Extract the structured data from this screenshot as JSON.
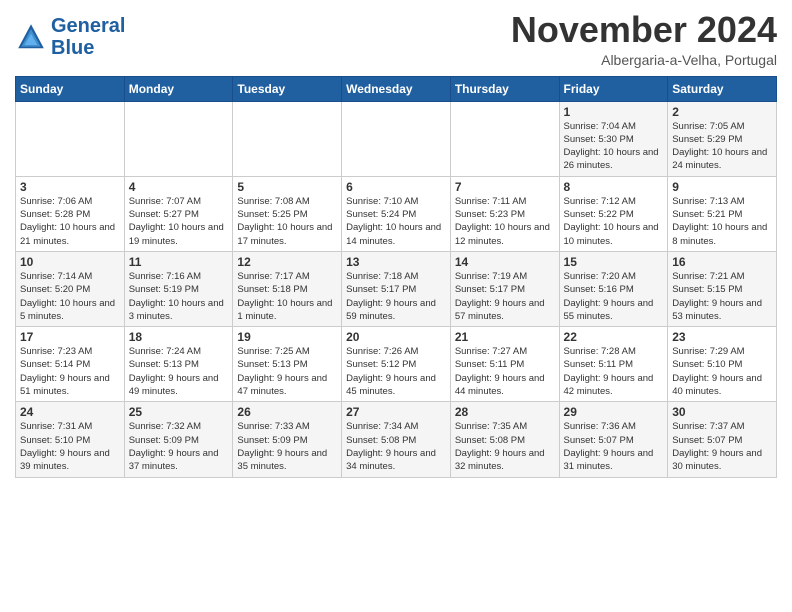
{
  "logo": {
    "line1": "General",
    "line2": "Blue"
  },
  "header": {
    "month": "November 2024",
    "location": "Albergaria-a-Velha, Portugal"
  },
  "weekdays": [
    "Sunday",
    "Monday",
    "Tuesday",
    "Wednesday",
    "Thursday",
    "Friday",
    "Saturday"
  ],
  "weeks": [
    [
      {
        "day": "",
        "info": ""
      },
      {
        "day": "",
        "info": ""
      },
      {
        "day": "",
        "info": ""
      },
      {
        "day": "",
        "info": ""
      },
      {
        "day": "",
        "info": ""
      },
      {
        "day": "1",
        "info": "Sunrise: 7:04 AM\nSunset: 5:30 PM\nDaylight: 10 hours and 26 minutes."
      },
      {
        "day": "2",
        "info": "Sunrise: 7:05 AM\nSunset: 5:29 PM\nDaylight: 10 hours and 24 minutes."
      }
    ],
    [
      {
        "day": "3",
        "info": "Sunrise: 7:06 AM\nSunset: 5:28 PM\nDaylight: 10 hours and 21 minutes."
      },
      {
        "day": "4",
        "info": "Sunrise: 7:07 AM\nSunset: 5:27 PM\nDaylight: 10 hours and 19 minutes."
      },
      {
        "day": "5",
        "info": "Sunrise: 7:08 AM\nSunset: 5:25 PM\nDaylight: 10 hours and 17 minutes."
      },
      {
        "day": "6",
        "info": "Sunrise: 7:10 AM\nSunset: 5:24 PM\nDaylight: 10 hours and 14 minutes."
      },
      {
        "day": "7",
        "info": "Sunrise: 7:11 AM\nSunset: 5:23 PM\nDaylight: 10 hours and 12 minutes."
      },
      {
        "day": "8",
        "info": "Sunrise: 7:12 AM\nSunset: 5:22 PM\nDaylight: 10 hours and 10 minutes."
      },
      {
        "day": "9",
        "info": "Sunrise: 7:13 AM\nSunset: 5:21 PM\nDaylight: 10 hours and 8 minutes."
      }
    ],
    [
      {
        "day": "10",
        "info": "Sunrise: 7:14 AM\nSunset: 5:20 PM\nDaylight: 10 hours and 5 minutes."
      },
      {
        "day": "11",
        "info": "Sunrise: 7:16 AM\nSunset: 5:19 PM\nDaylight: 10 hours and 3 minutes."
      },
      {
        "day": "12",
        "info": "Sunrise: 7:17 AM\nSunset: 5:18 PM\nDaylight: 10 hours and 1 minute."
      },
      {
        "day": "13",
        "info": "Sunrise: 7:18 AM\nSunset: 5:17 PM\nDaylight: 9 hours and 59 minutes."
      },
      {
        "day": "14",
        "info": "Sunrise: 7:19 AM\nSunset: 5:17 PM\nDaylight: 9 hours and 57 minutes."
      },
      {
        "day": "15",
        "info": "Sunrise: 7:20 AM\nSunset: 5:16 PM\nDaylight: 9 hours and 55 minutes."
      },
      {
        "day": "16",
        "info": "Sunrise: 7:21 AM\nSunset: 5:15 PM\nDaylight: 9 hours and 53 minutes."
      }
    ],
    [
      {
        "day": "17",
        "info": "Sunrise: 7:23 AM\nSunset: 5:14 PM\nDaylight: 9 hours and 51 minutes."
      },
      {
        "day": "18",
        "info": "Sunrise: 7:24 AM\nSunset: 5:13 PM\nDaylight: 9 hours and 49 minutes."
      },
      {
        "day": "19",
        "info": "Sunrise: 7:25 AM\nSunset: 5:13 PM\nDaylight: 9 hours and 47 minutes."
      },
      {
        "day": "20",
        "info": "Sunrise: 7:26 AM\nSunset: 5:12 PM\nDaylight: 9 hours and 45 minutes."
      },
      {
        "day": "21",
        "info": "Sunrise: 7:27 AM\nSunset: 5:11 PM\nDaylight: 9 hours and 44 minutes."
      },
      {
        "day": "22",
        "info": "Sunrise: 7:28 AM\nSunset: 5:11 PM\nDaylight: 9 hours and 42 minutes."
      },
      {
        "day": "23",
        "info": "Sunrise: 7:29 AM\nSunset: 5:10 PM\nDaylight: 9 hours and 40 minutes."
      }
    ],
    [
      {
        "day": "24",
        "info": "Sunrise: 7:31 AM\nSunset: 5:10 PM\nDaylight: 9 hours and 39 minutes."
      },
      {
        "day": "25",
        "info": "Sunrise: 7:32 AM\nSunset: 5:09 PM\nDaylight: 9 hours and 37 minutes."
      },
      {
        "day": "26",
        "info": "Sunrise: 7:33 AM\nSunset: 5:09 PM\nDaylight: 9 hours and 35 minutes."
      },
      {
        "day": "27",
        "info": "Sunrise: 7:34 AM\nSunset: 5:08 PM\nDaylight: 9 hours and 34 minutes."
      },
      {
        "day": "28",
        "info": "Sunrise: 7:35 AM\nSunset: 5:08 PM\nDaylight: 9 hours and 32 minutes."
      },
      {
        "day": "29",
        "info": "Sunrise: 7:36 AM\nSunset: 5:07 PM\nDaylight: 9 hours and 31 minutes."
      },
      {
        "day": "30",
        "info": "Sunrise: 7:37 AM\nSunset: 5:07 PM\nDaylight: 9 hours and 30 minutes."
      }
    ]
  ]
}
